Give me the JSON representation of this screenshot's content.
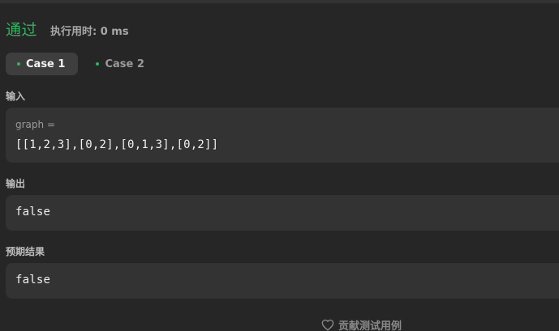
{
  "result": {
    "status": "通过",
    "runtime": "执行用时: 0 ms"
  },
  "tabs": [
    {
      "label": "Case 1",
      "active": true
    },
    {
      "label": "Case 2",
      "active": false
    }
  ],
  "input": {
    "section_label": "输入",
    "param_name": "graph =",
    "param_value": "[[1,2,3],[0,2],[0,1,3],[0,2]]"
  },
  "output": {
    "section_label": "输出",
    "value": "false"
  },
  "expected": {
    "section_label": "预期结果",
    "value": "false"
  },
  "footer": {
    "contribute_label": "贡献测试用例",
    "icon": "heart-icon"
  },
  "colors": {
    "accent_green": "#2db55d",
    "background": "#262626",
    "panel": "#333333"
  }
}
